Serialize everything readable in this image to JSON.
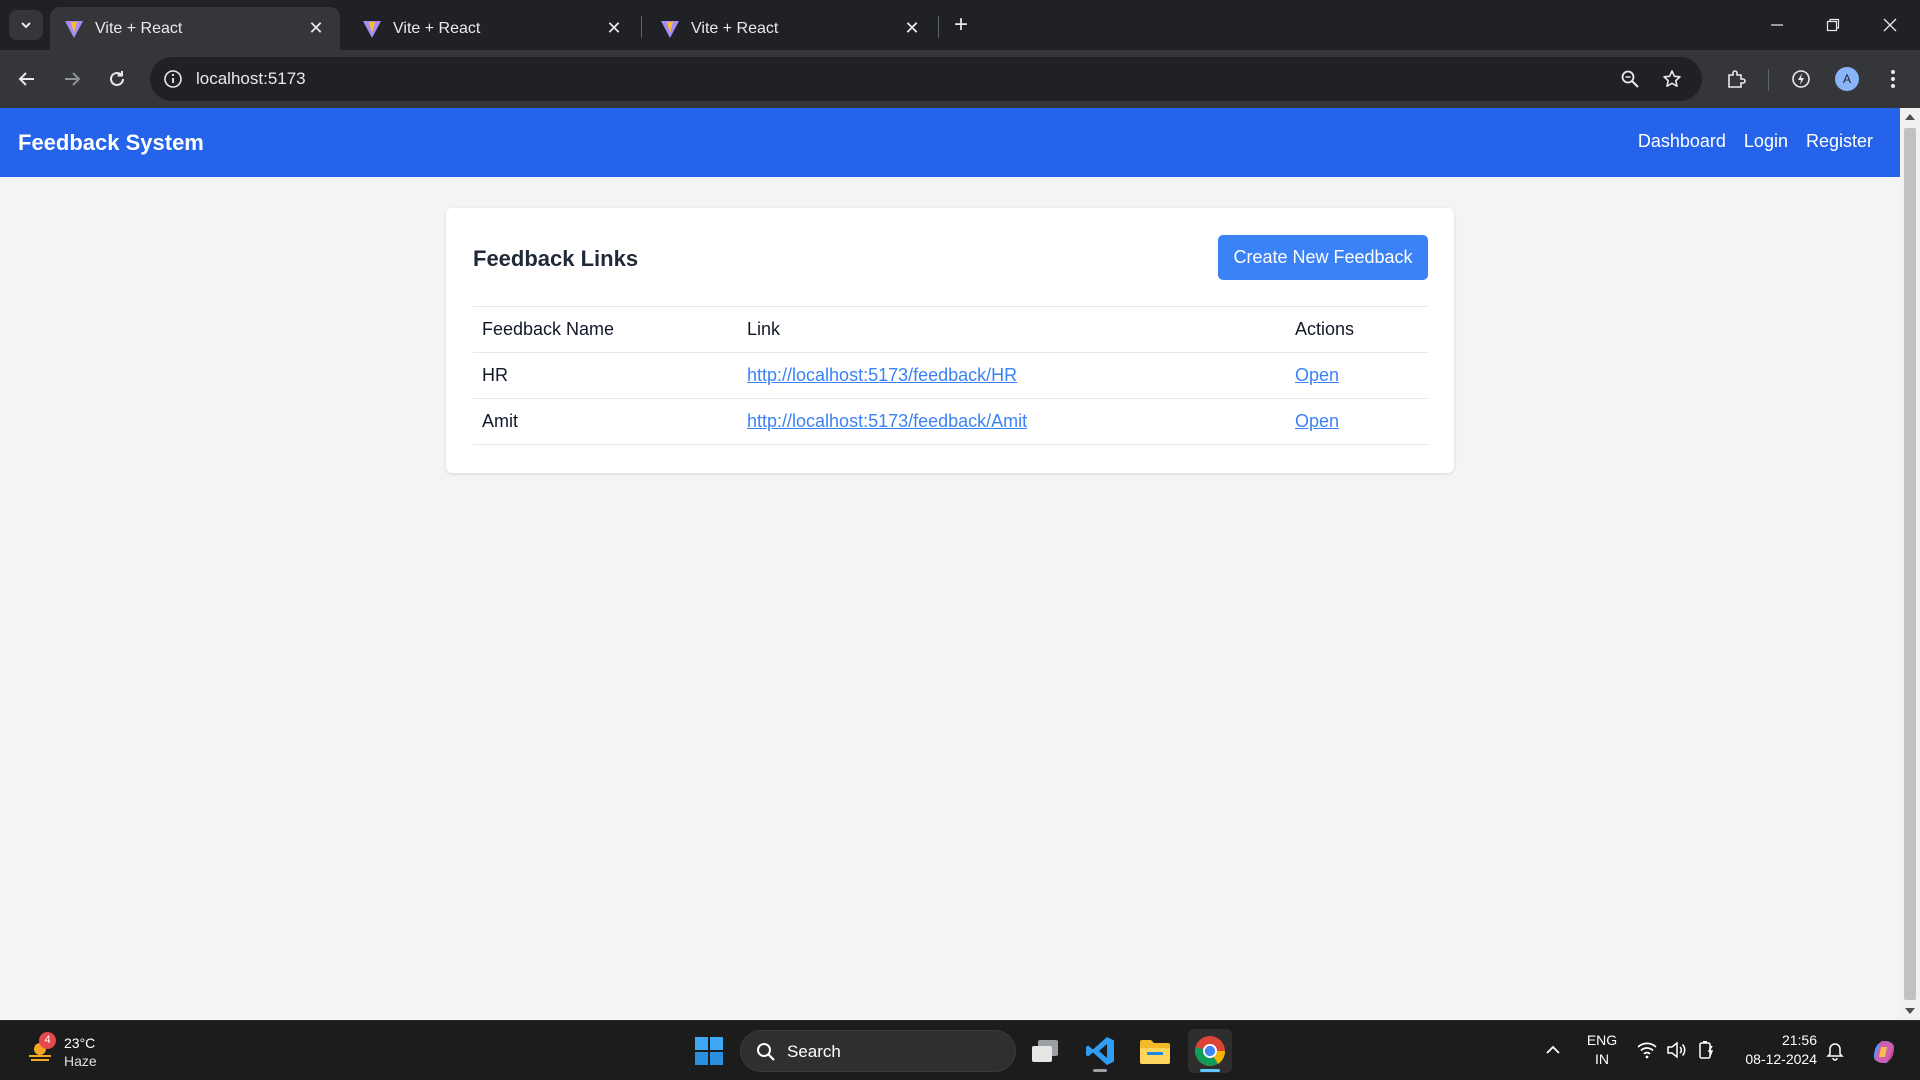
{
  "browser": {
    "tabs": [
      {
        "title": "Vite + React",
        "active": true
      },
      {
        "title": "Vite + React",
        "active": false
      },
      {
        "title": "Vite + React",
        "active": false
      }
    ],
    "url": "localhost:5173",
    "profile_initial": "A"
  },
  "app": {
    "brand": "Feedback System",
    "nav": {
      "dashboard": "Dashboard",
      "login": "Login",
      "register": "Register"
    },
    "card": {
      "title": "Feedback Links",
      "create_button": "Create New Feedback",
      "columns": [
        "Feedback Name",
        "Link",
        "Actions"
      ],
      "rows": [
        {
          "name": "HR",
          "link": "http://localhost:5173/feedback/HR",
          "action": "Open"
        },
        {
          "name": "Amit",
          "link": "http://localhost:5173/feedback/Amit",
          "action": "Open"
        }
      ]
    },
    "colors": {
      "navbar": "#2563eb",
      "button": "#3b82f6",
      "link": "#3b82f6",
      "page_bg": "#f3f4f6"
    }
  },
  "taskbar": {
    "weather": {
      "badge": "4",
      "temp": "23°C",
      "condition": "Haze"
    },
    "search_placeholder": "Search",
    "lang": {
      "line1": "ENG",
      "line2": "IN"
    },
    "time": "21:56",
    "date": "08-12-2024"
  }
}
